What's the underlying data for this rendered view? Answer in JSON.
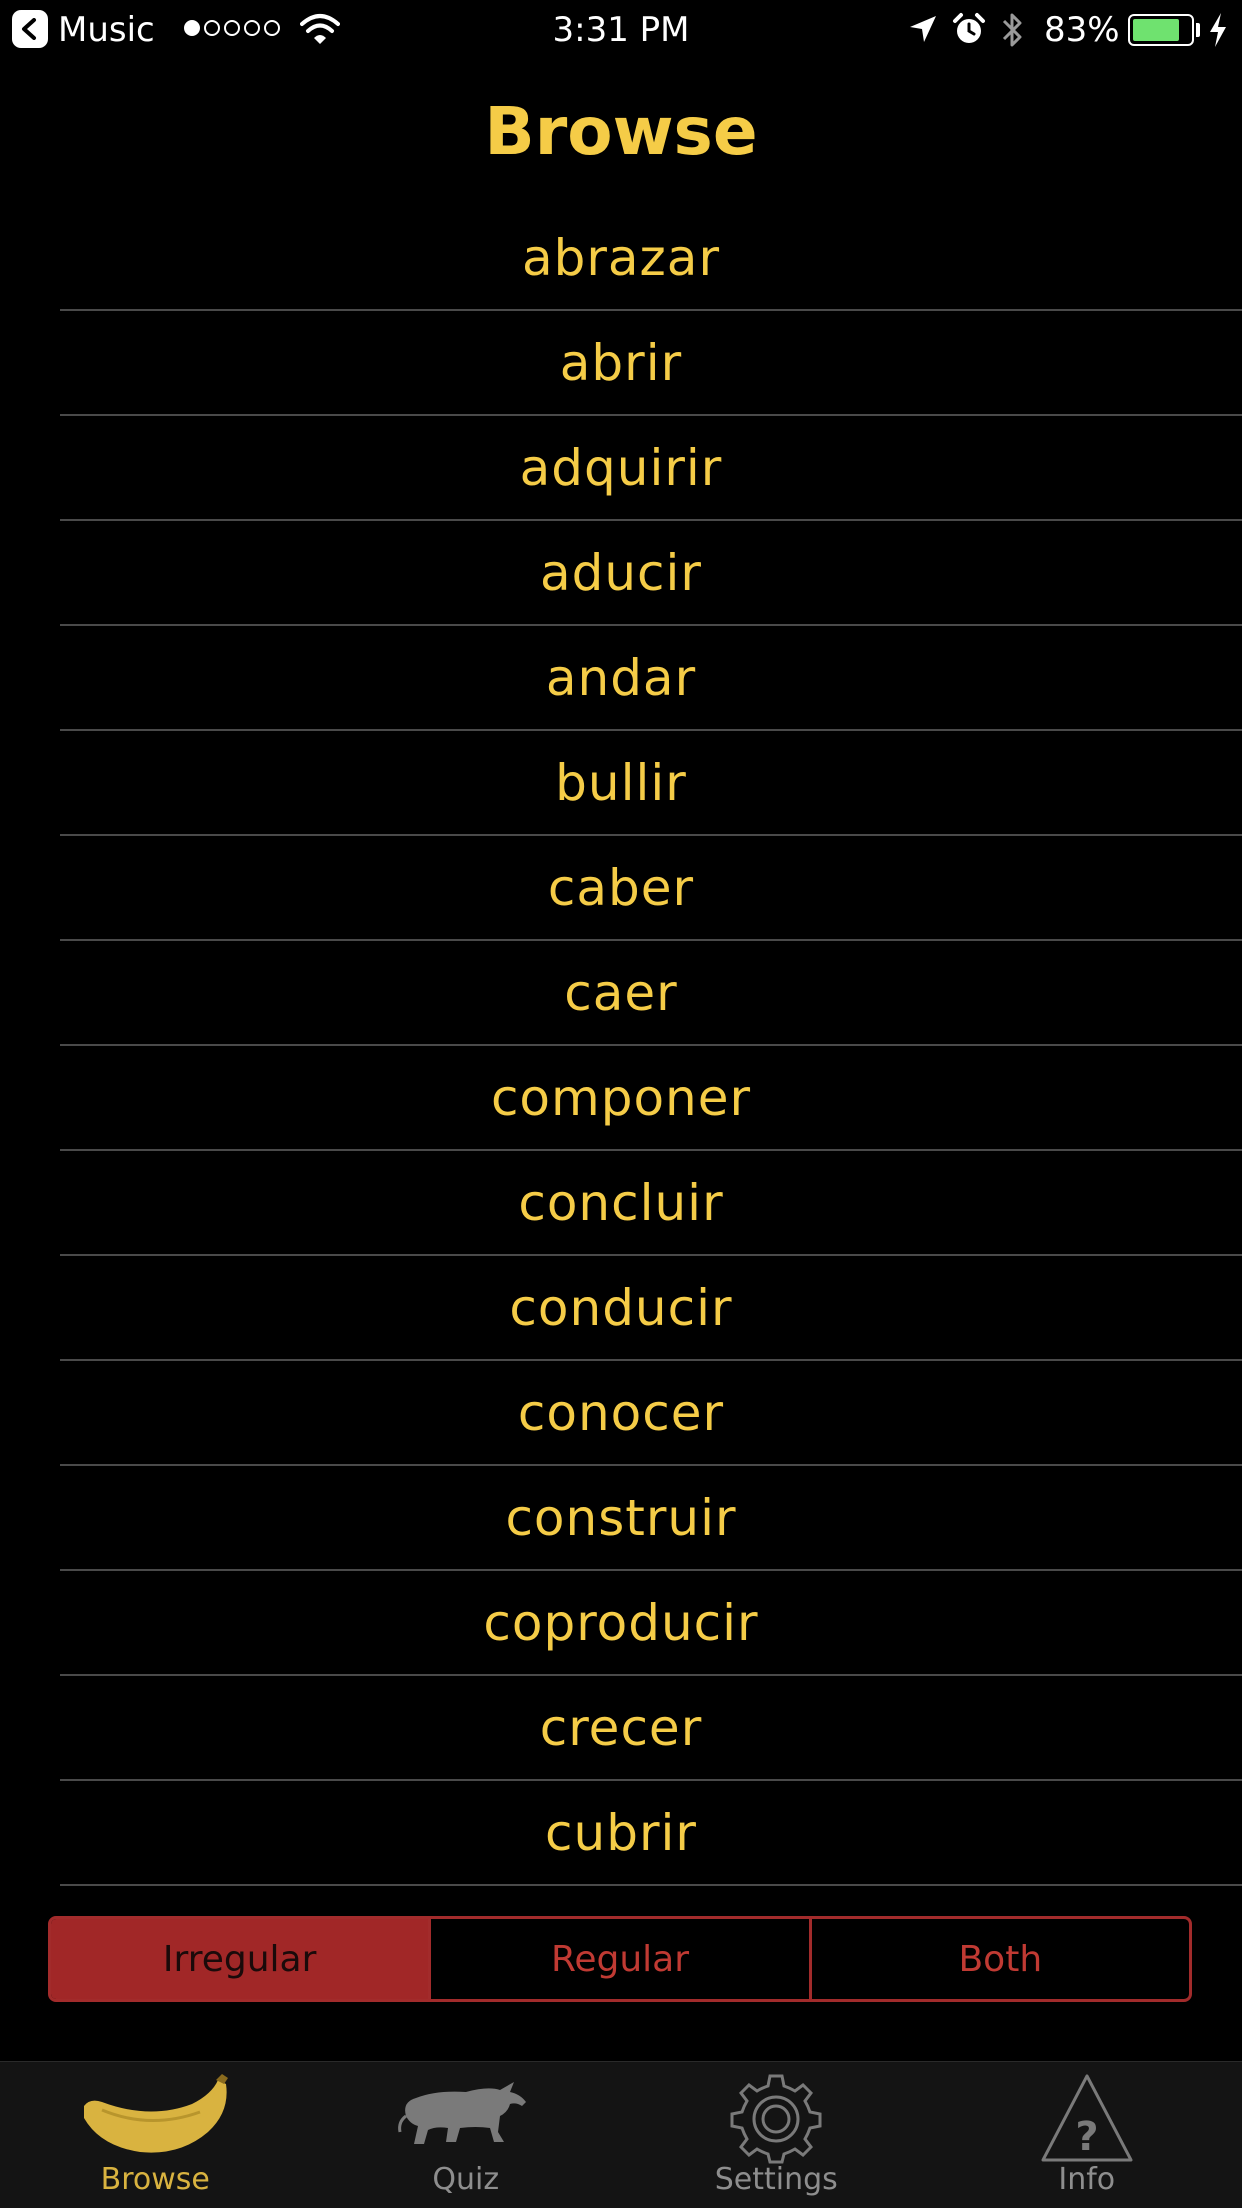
{
  "status_bar": {
    "back_app": "Music",
    "signal_dots_filled": 1,
    "signal_dots_total": 5,
    "time": "3:31 PM",
    "battery_percent": "83%",
    "battery_level": 0.83
  },
  "title": "Browse",
  "verbs": [
    "abrazar",
    "abrir",
    "adquirir",
    "aducir",
    "andar",
    "bullir",
    "caber",
    "caer",
    "componer",
    "concluir",
    "conducir",
    "conocer",
    "construir",
    "coproducir",
    "crecer",
    "cubrir"
  ],
  "filter": {
    "options": [
      "Irregular",
      "Regular",
      "Both"
    ],
    "selected": "Irregular"
  },
  "tabs": [
    {
      "label": "Browse",
      "icon": "banana-icon",
      "active": true
    },
    {
      "label": "Quiz",
      "icon": "bull-icon",
      "active": false
    },
    {
      "label": "Settings",
      "icon": "gear-icon",
      "active": false
    },
    {
      "label": "Info",
      "icon": "question-triangle-icon",
      "active": false
    }
  ],
  "colors": {
    "accent_yellow": "#f5cc47",
    "accent_red": "#a12727",
    "background": "#000000",
    "tab_bar": "#141414"
  }
}
